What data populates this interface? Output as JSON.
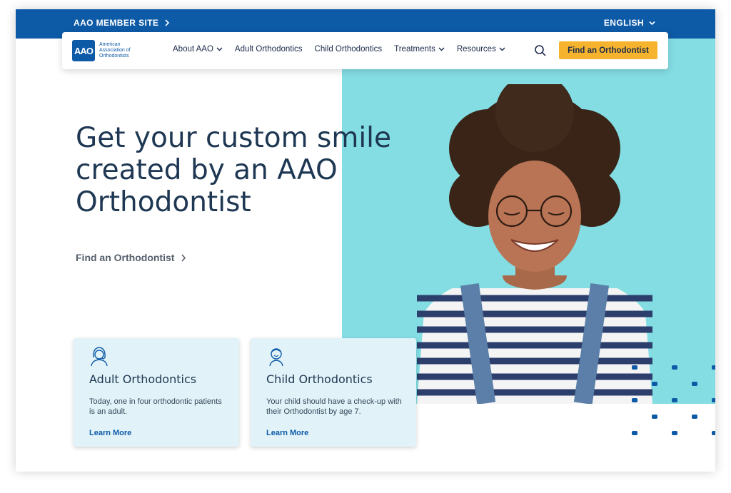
{
  "topbar": {
    "member_link": "AAO MEMBER SITE",
    "language": "ENGLISH"
  },
  "logo": {
    "mark": "AAO",
    "line1": "American",
    "line2": "Association of",
    "line3": "Orthodontists"
  },
  "nav": {
    "items": [
      {
        "label": "About AAO",
        "has_dropdown": true
      },
      {
        "label": "Adult Orthodontics",
        "has_dropdown": false
      },
      {
        "label": "Child Orthodontics",
        "has_dropdown": false
      },
      {
        "label": "Treatments",
        "has_dropdown": true
      },
      {
        "label": "Resources",
        "has_dropdown": true
      }
    ],
    "search_icon": "search-icon",
    "cta_label": "Find an Orthodontist"
  },
  "hero": {
    "title": "Get your custom smile created by an AAO Orthodontist",
    "link_label": "Find an Orthodontist"
  },
  "cards": [
    {
      "icon": "adult-woman-icon",
      "title": "Adult Orthodontics",
      "text": "Today, one in four orthodontic patients is an adult.",
      "link": "Learn More"
    },
    {
      "icon": "child-icon",
      "title": "Child Orthodontics",
      "text": "Your child should have  a check-up with their  Orthodontist by age 7.",
      "link": "Learn More"
    }
  ],
  "colors": {
    "brand_blue": "#0d5aa7",
    "teal": "#83dde3",
    "cta_yellow": "#f6b42e",
    "heading_navy": "#1e3753",
    "card_bg": "#e1f3f8"
  }
}
